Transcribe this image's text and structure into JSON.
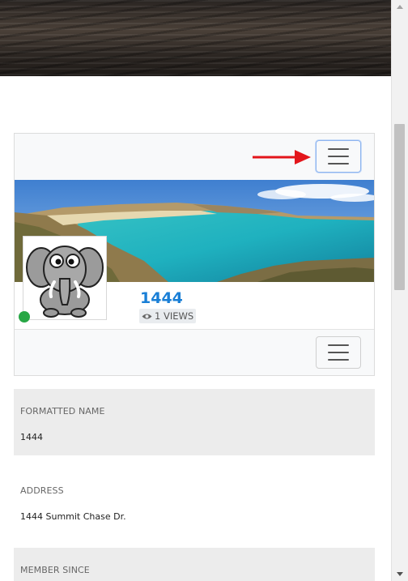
{
  "profile": {
    "name": "1444",
    "views": "1 VIEWS"
  },
  "details": [
    {
      "label": "FORMATTED NAME",
      "value": "1444"
    },
    {
      "label": "ADDRESS",
      "value": "1444 Summit Chase Dr."
    },
    {
      "label": "MEMBER SINCE",
      "value": ""
    }
  ],
  "icons": {
    "menu": "hamburger-icon",
    "views": "eye-icon",
    "status": "online-dot",
    "annotation": "red-arrow"
  },
  "colors": {
    "link": "#1a7fd6",
    "online": "#28a745",
    "arrow": "#e3161b",
    "shaded_section": "#ececec"
  }
}
